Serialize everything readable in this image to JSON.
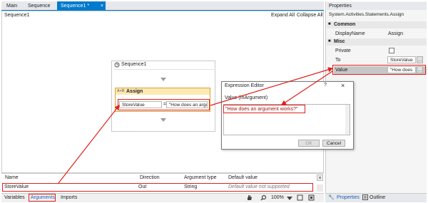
{
  "tabs": [
    {
      "label": "Main"
    },
    {
      "label": "Sequence"
    },
    {
      "label": "Sequence1 *"
    }
  ],
  "tab_close_glyph": "×",
  "designer": {
    "breadcrumb": "Sequence1",
    "expand_all": "Expand All",
    "collapse_all": "Collapse All",
    "sequence_title": "Sequence1",
    "assign_title": "Assign",
    "assign_to": "StoreValue",
    "assign_eq": "=",
    "assign_value": "\"How does an argu"
  },
  "arguments_grid": {
    "headers": [
      "Name",
      "Direction",
      "Argument type",
      "Default value"
    ],
    "row": {
      "name": "StoreValue",
      "direction": "Out",
      "type": "String",
      "default": "Default value not supported"
    },
    "delete_glyph": "×"
  },
  "bottom": {
    "variables": "Variables",
    "arguments": "Arguments",
    "imports": "Imports",
    "zoom": "100%"
  },
  "properties": {
    "title": "Properties",
    "class": "System.Activities.Statements.Assign",
    "common": "Common",
    "displayname_label": "DisplayName",
    "displayname_value": "Assign",
    "misc": "Misc",
    "private_label": "Private",
    "to_label": "To",
    "to_value": "StoreValue",
    "value_label": "Value",
    "value_value": "\"How does",
    "ellipsis": "...",
    "tab_properties": "Properties",
    "tab_outline": "Outline"
  },
  "dialog": {
    "title": "Expression Editor",
    "help": "?",
    "label": "Value (InArgument)",
    "expression": "\"How does an argument works?\"",
    "ok": "OK",
    "cancel": "Cancel"
  },
  "colors": {
    "accent": "#007acc",
    "annotation": "#e0201b",
    "assign_border": "#d7a234"
  }
}
